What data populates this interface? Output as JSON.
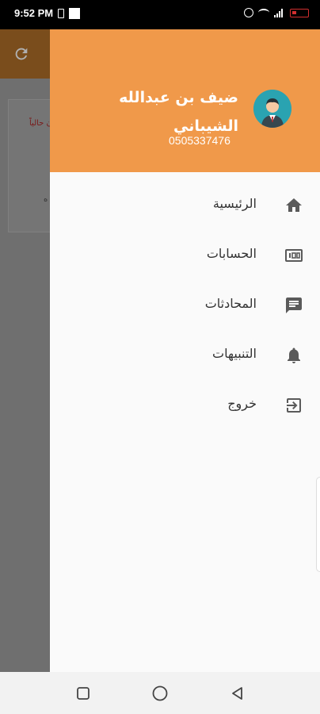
{
  "status_bar": {
    "time": "9:52 PM"
  },
  "drawer": {
    "user": {
      "name": "ضيف بن عبدالله الشيباني",
      "phone": "0505337476"
    },
    "menu": [
      {
        "label": "الرئيسية",
        "icon": "home-icon"
      },
      {
        "label": "الحسابات",
        "icon": "accounts-icon"
      },
      {
        "label": "المحادثات",
        "icon": "chat-icon"
      },
      {
        "label": "التنبيهات",
        "icon": "bell-icon"
      },
      {
        "label": "خروج",
        "icon": "logout-icon"
      }
    ]
  },
  "background_app": {
    "card_text_1": "ن حالياً",
    "card_text_2": "ه"
  },
  "colors": {
    "header": "#f0994a",
    "appbar_dimmed": "#7a4d1c",
    "drawer_bg": "#fafafa",
    "menu_text": "#333333"
  }
}
